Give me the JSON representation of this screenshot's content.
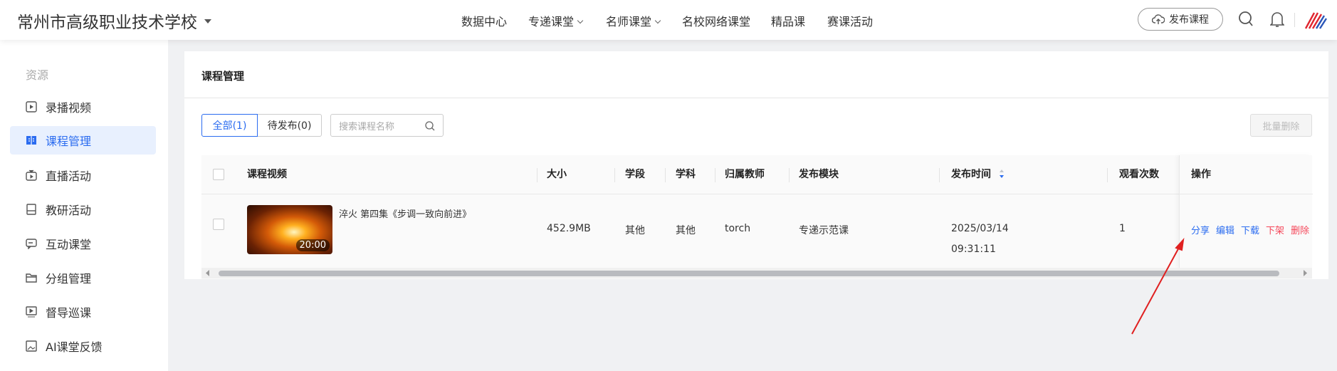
{
  "header": {
    "school": "常州市高级职业技术学校",
    "nav": [
      "数据中心",
      "专递课堂",
      "名师课堂",
      "名校网络课堂",
      "精品课",
      "赛课活动"
    ],
    "publish": "发布课程"
  },
  "sidebar": {
    "section": "资源",
    "items": [
      "录播视频",
      "课程管理",
      "直播活动",
      "教研活动",
      "互动课堂",
      "分组管理",
      "督导巡课",
      "AI课堂反馈"
    ]
  },
  "main": {
    "title": "课程管理",
    "tabs": [
      "全部(1)",
      "待发布(0)"
    ],
    "search_placeholder": "搜索课程名称",
    "batch_delete": "批量删除",
    "columns": [
      "课程视频",
      "大小",
      "学段",
      "学科",
      "归属教师",
      "发布模块",
      "发布时间",
      "观看次数",
      "操作"
    ],
    "rows": [
      {
        "title": "淬火 第四集《步调一致向前进》",
        "duration": "20:00",
        "size": "452.9MB",
        "stage": "其他",
        "subject": "其他",
        "teacher": "torch",
        "module": "专递示范课",
        "date": "2025/03/14",
        "time": "09:31:11",
        "views": "1",
        "ops": [
          "分享",
          "编辑",
          "下载",
          "下架",
          "删除"
        ]
      }
    ]
  },
  "colors": {
    "accent": "#2b6cf0",
    "danger": "#f5475a"
  }
}
